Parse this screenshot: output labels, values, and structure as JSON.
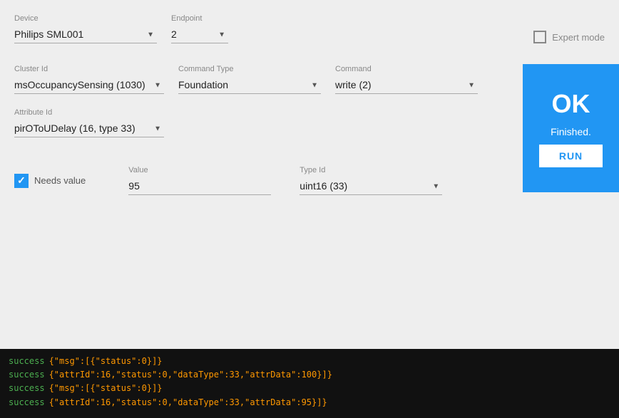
{
  "device": {
    "label": "Device",
    "value": "Philips SML001",
    "options": [
      "Philips SML001"
    ]
  },
  "endpoint": {
    "label": "Endpoint",
    "value": "2",
    "options": [
      "2"
    ]
  },
  "expert_mode": {
    "label": "Expert mode",
    "checked": false
  },
  "cluster_id": {
    "label": "Cluster Id",
    "value": "msOccupancySensing (1030)",
    "options": [
      "msOccupancySensing (1030)"
    ]
  },
  "command_type": {
    "label": "Command Type",
    "value": "Foundation",
    "options": [
      "Foundation"
    ]
  },
  "command": {
    "label": "Command",
    "value": "write (2)",
    "options": [
      "write (2)"
    ]
  },
  "attribute_id": {
    "label": "Attribute Id",
    "value": "pirOToUDelay (16, type 33)",
    "options": [
      "pirOToUDelay (16, type 33)"
    ]
  },
  "needs_value": {
    "label": "Needs value",
    "checked": true
  },
  "value": {
    "label": "Value",
    "value": "95"
  },
  "type_id": {
    "label": "Type Id",
    "value": "uint16 (33)",
    "options": [
      "uint16 (33)"
    ]
  },
  "ok_panel": {
    "title": "OK",
    "subtitle": "Finished.",
    "run_button": "RUN"
  },
  "console": {
    "lines": [
      {
        "status": "success",
        "json": "{\"msg\":[{\"status\":0}]}"
      },
      {
        "status": "success",
        "json": "{\"attrId\":16,\"status\":0,\"dataType\":33,\"attrData\":100}]}"
      },
      {
        "status": "success",
        "json": "{\"msg\":[{\"status\":0}]}"
      },
      {
        "status": "success",
        "json": "{\"attrId\":16,\"status\":0,\"dataType\":33,\"attrData\":95}]}"
      }
    ]
  }
}
